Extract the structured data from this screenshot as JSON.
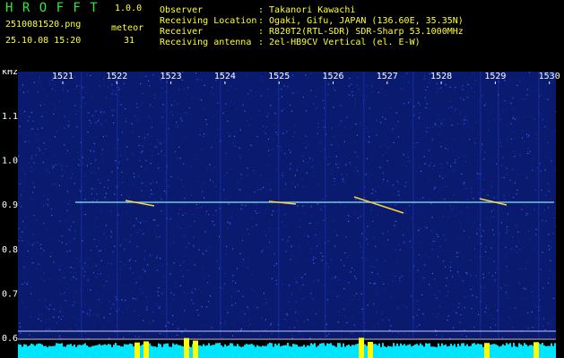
{
  "app": {
    "name": "H R O F F T",
    "version": "1.0.0"
  },
  "file": {
    "name": "2510081520.png",
    "datetime": "25.10.08 15:20"
  },
  "meteor": {
    "label": "meteor",
    "count": "31"
  },
  "info": [
    {
      "label": "Observer",
      "value": ": Takanori Kawachi"
    },
    {
      "label": "Receiving Location",
      "value": ": Ogaki, Gifu, JAPAN (136.60E, 35.35N)"
    },
    {
      "label": "Receiver",
      "value": ": R820T2(RTL-SDR) SDR-Sharp 53.1000MHz"
    },
    {
      "label": "Receiving antenna",
      "value": ": 2el-HB9CV Vertical (el. E-W)"
    }
  ],
  "axes": {
    "y_unit": "kHz",
    "x_ticks": [
      "1521",
      "1522",
      "1523",
      "1524",
      "1525",
      "1526",
      "1527",
      "1528",
      "1529",
      "1530"
    ],
    "y_ticks": [
      "1.1",
      "1.0",
      "0.9",
      "0.8",
      "0.7",
      "0.6"
    ]
  },
  "colors": {
    "background": "#000000",
    "noise": "#0a1a6e",
    "signal_line": "#7fe8ff",
    "axis_text": "#ffffff",
    "app_name": "#39e639",
    "info_text": "#ffff33",
    "level_bar": "#00e5ff",
    "level_peak": "#ffff00"
  }
}
